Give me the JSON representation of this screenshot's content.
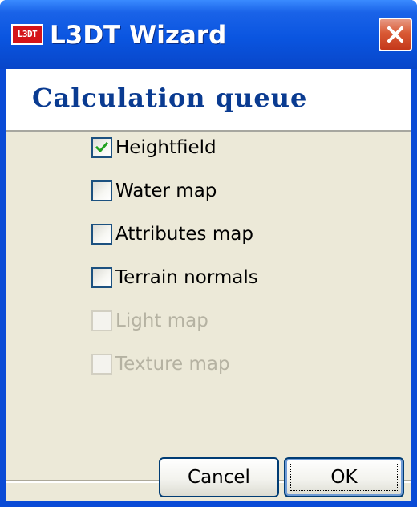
{
  "window": {
    "title": "L3DT Wizard",
    "app_icon_text": "L3DT",
    "close_icon": "close-icon"
  },
  "header": {
    "title": "Calculation queue"
  },
  "options": [
    {
      "label": "Heightfield",
      "checked": true,
      "enabled": true
    },
    {
      "label": "Water map",
      "checked": false,
      "enabled": true
    },
    {
      "label": "Attributes map",
      "checked": false,
      "enabled": true
    },
    {
      "label": "Terrain normals",
      "checked": false,
      "enabled": true
    },
    {
      "label": "Light map",
      "checked": false,
      "enabled": false
    },
    {
      "label": "Texture map",
      "checked": false,
      "enabled": false
    }
  ],
  "buttons": {
    "cancel": "Cancel",
    "ok": "OK"
  },
  "colors": {
    "titlebar": "#0a55e0",
    "title_text": "#0a3b91",
    "dialog_bg": "#ece9d8",
    "check_mark": "#21a121",
    "disabled_text": "#b5b2a2",
    "close_button": "#d95a35"
  }
}
